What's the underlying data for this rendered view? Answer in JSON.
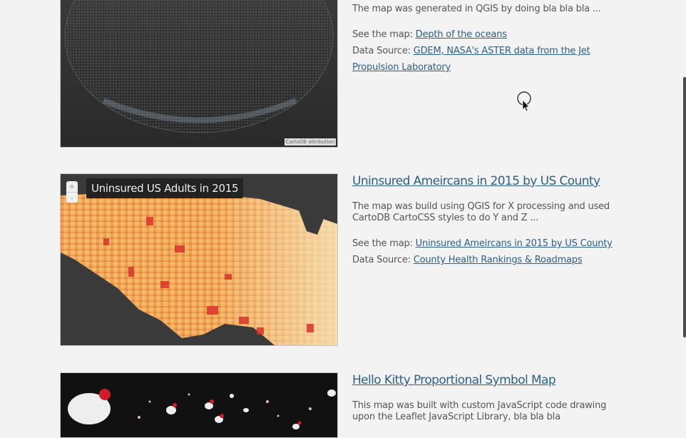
{
  "entries": [
    {
      "id": "oceans",
      "title": "",
      "description": "The map was generated in QGIS by doing bla bla bla ...",
      "see_prefix": "See the map:",
      "see_link": "Depth of the oceans",
      "source_prefix": "Data Source:",
      "source_link": "GDEM, NASA's ASTER data from the Jet Propulsion Laboratory",
      "map_attribution": "CartoDB attribution"
    },
    {
      "id": "uninsured",
      "title": "Uninsured Ameircans in 2015 by US County",
      "description": "The map was build using QGIS for X processing and used CartoDB CartoCSS styles to do Y and Z ...",
      "see_prefix": "See the map:",
      "see_link": "Uninsured Ameircans in 2015 by US County",
      "source_prefix": "Data Source:",
      "source_link": "County Health Rankings & Roadmaps",
      "map_legend": "Uninsured US Adults in 2015",
      "zoom_in": "+",
      "zoom_out": "-"
    },
    {
      "id": "hellokitty",
      "title": "Hello Kitty Proportional Symbol Map",
      "description": "This map was built with custom JavaScript code drawing upon the Leaflet JavaScript Library, bla bla bla"
    }
  ]
}
